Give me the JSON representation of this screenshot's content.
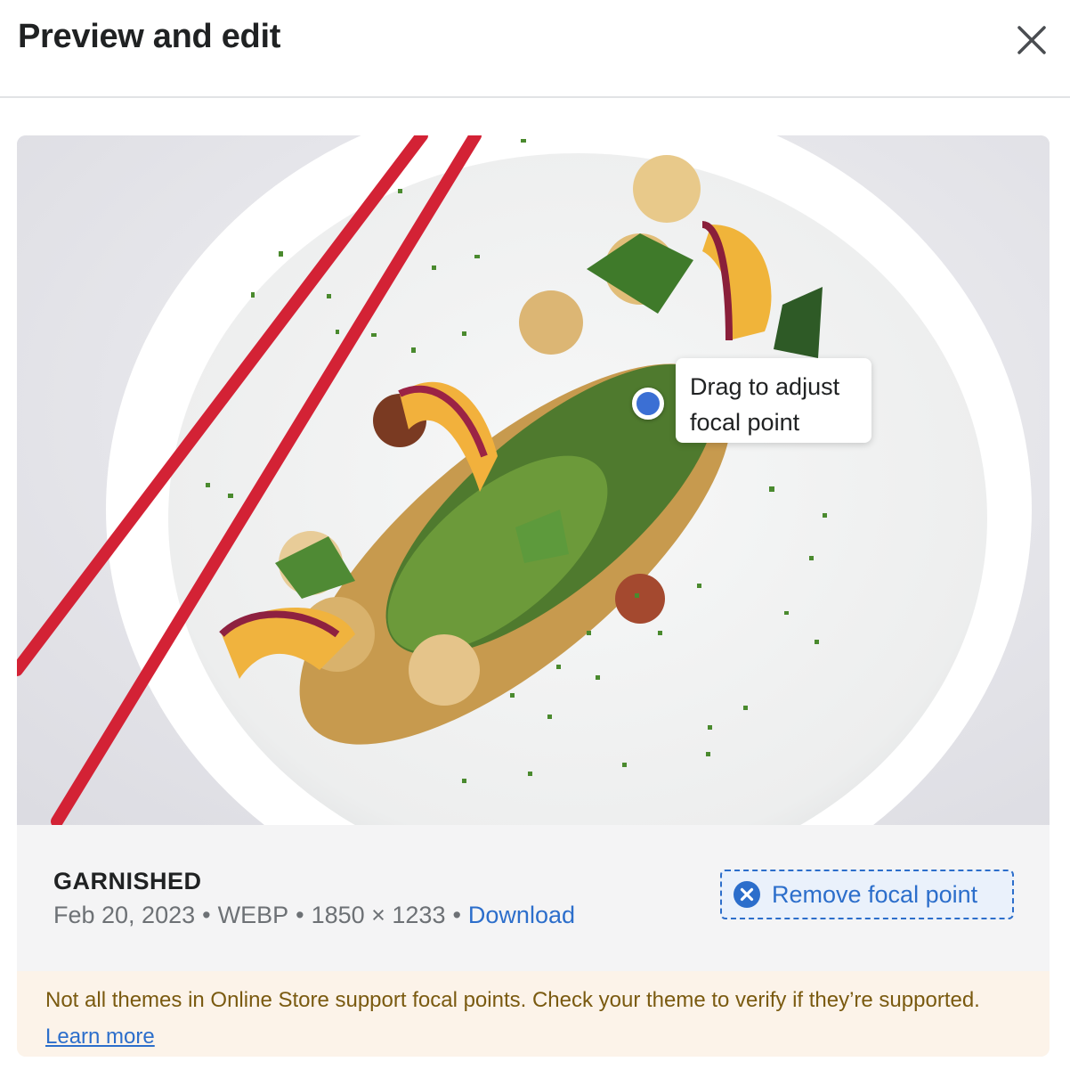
{
  "header": {
    "title": "Preview and edit",
    "close_icon": "close-x-icon"
  },
  "image": {
    "description_icon": "food-photo",
    "tooltip_line1": "Drag to adjust",
    "tooltip_line2": "focal point"
  },
  "file": {
    "name": "GARNISHED",
    "date": "Feb 20, 2023",
    "format": "WEBP",
    "dimensions": "1850 × 1233",
    "separator": "•",
    "download_label": "Download"
  },
  "actions": {
    "remove_focal_label": "Remove focal point",
    "remove_icon": "circle-x-icon"
  },
  "banner": {
    "text": "Not all themes in Online Store support focal points. Check your theme to verify if they’re supported.",
    "learn_more": "Learn more"
  },
  "colors": {
    "accent": "#2c6ecb",
    "focal_dot": "#3b6fd4",
    "banner_bg": "#fcf3e9",
    "banner_text": "#7a5a10",
    "muted_text": "#6d7175",
    "panel_bg": "#f4f4f5"
  }
}
